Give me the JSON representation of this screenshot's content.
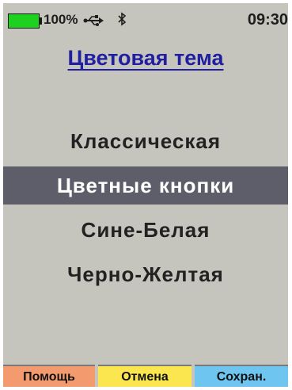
{
  "status": {
    "battery_percent": "100%",
    "battery_level": 1.0,
    "battery_color": "#1ed11e",
    "usb_icon": "usb-icon",
    "bluetooth_icon": "bluetooth-icon",
    "time": "09:30"
  },
  "title": "Цветовая тема",
  "menu": {
    "items": [
      {
        "label": "Классическая",
        "selected": false
      },
      {
        "label": "Цветные кнопки",
        "selected": true
      },
      {
        "label": "Сине-Белая",
        "selected": false
      },
      {
        "label": "Черно-Желтая",
        "selected": false
      }
    ],
    "selected_background": "#5e5e6a"
  },
  "softkeys": {
    "help_label": "Помощь",
    "cancel_label": "Отмена",
    "save_label": "Сохран.",
    "help_color": "#f39a6e",
    "cancel_color": "#fbe64f",
    "save_color": "#6ec6f0"
  },
  "colors": {
    "screen_background": "#c5c5bd",
    "title_color": "#1f1fa0"
  }
}
